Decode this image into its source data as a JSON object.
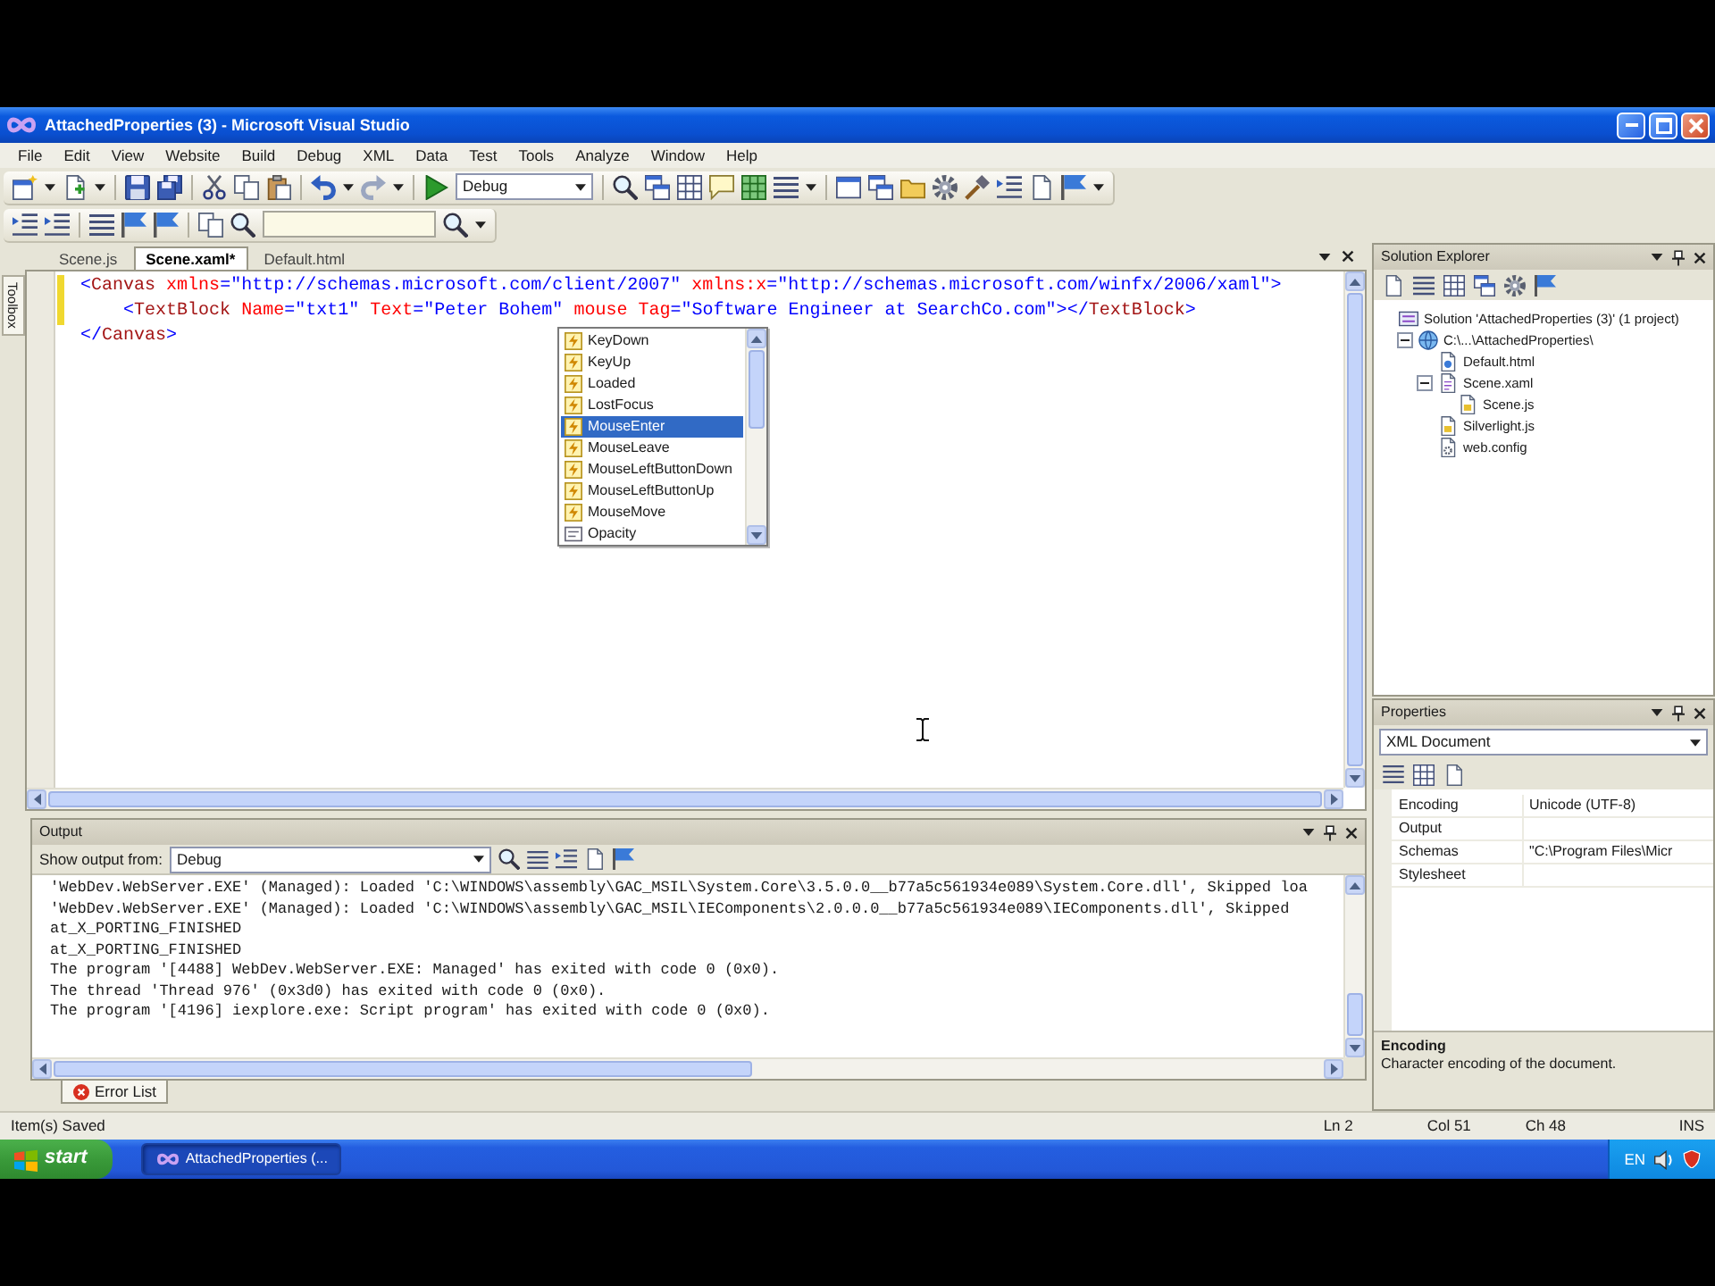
{
  "window": {
    "title": "AttachedProperties (3) - Microsoft Visual Studio"
  },
  "menu": [
    "File",
    "Edit",
    "View",
    "Website",
    "Build",
    "Debug",
    "XML",
    "Data",
    "Test",
    "Tools",
    "Analyze",
    "Window",
    "Help"
  ],
  "toolbar": {
    "configuration": "Debug"
  },
  "toolbox": {
    "label": "Toolbox"
  },
  "editor": {
    "tabs": [
      {
        "label": "Scene.js",
        "selected": false
      },
      {
        "label": "Scene.xaml*",
        "selected": true
      },
      {
        "label": "Default.html",
        "selected": false
      }
    ],
    "lines": [
      {
        "text": "<Canvas xmlns=\"http://schemas.microsoft.com/client/2007\" xmlns:x=\"http://schemas.microsoft.com/winfx/2006/xaml\">",
        "changed": true
      },
      {
        "text": "    <TextBlock Name=\"txt1\" Text=\"Peter Bohem\" mouse Tag=\"Software Engineer at SearchCo.com\"></TextBlock>",
        "changed": true
      },
      {
        "text": "</Canvas>",
        "changed": false
      }
    ],
    "completion": {
      "items": [
        {
          "label": "KeyDown",
          "kind": "event",
          "selected": false
        },
        {
          "label": "KeyUp",
          "kind": "event",
          "selected": false
        },
        {
          "label": "Loaded",
          "kind": "event",
          "selected": false
        },
        {
          "label": "LostFocus",
          "kind": "event",
          "selected": false
        },
        {
          "label": "MouseEnter",
          "kind": "event",
          "selected": true
        },
        {
          "label": "MouseLeave",
          "kind": "event",
          "selected": false
        },
        {
          "label": "MouseLeftButtonDown",
          "kind": "event",
          "selected": false
        },
        {
          "label": "MouseLeftButtonUp",
          "kind": "event",
          "selected": false
        },
        {
          "label": "MouseMove",
          "kind": "event",
          "selected": false
        },
        {
          "label": "Opacity",
          "kind": "property",
          "selected": false
        }
      ]
    }
  },
  "solution_explorer": {
    "title": "Solution Explorer",
    "tree": [
      {
        "label": "Solution 'AttachedProperties (3)' (1 project)",
        "kind": "solution",
        "children": [
          {
            "label": "C:\\...\\AttachedProperties\\",
            "kind": "website",
            "expanded": true,
            "children": [
              {
                "label": "Default.html",
                "kind": "html"
              },
              {
                "label": "Scene.xaml",
                "kind": "xaml",
                "expanded": true,
                "children": [
                  {
                    "label": "Scene.js",
                    "kind": "js"
                  }
                ]
              },
              {
                "label": "Silverlight.js",
                "kind": "js"
              },
              {
                "label": "web.config",
                "kind": "config"
              }
            ]
          }
        ]
      }
    ]
  },
  "properties": {
    "title": "Properties",
    "object": "XML Document",
    "rows": [
      {
        "name": "Encoding",
        "value": "Unicode (UTF-8)"
      },
      {
        "name": "Output"
      },
      {
        "name": "Schemas",
        "value": "\"C:\\Program Files\\Micr"
      },
      {
        "name": "Stylesheet"
      }
    ],
    "description": {
      "title": "Encoding",
      "text": "Character encoding of the document."
    }
  },
  "output": {
    "title": "Output",
    "source_label": "Show output from:",
    "source": "Debug",
    "lines": [
      "'WebDev.WebServer.EXE' (Managed): Loaded 'C:\\WINDOWS\\assembly\\GAC_MSIL\\System.Core\\3.5.0.0__b77a5c561934e089\\System.Core.dll', Skipped loa",
      "'WebDev.WebServer.EXE' (Managed): Loaded 'C:\\WINDOWS\\assembly\\GAC_MSIL\\IEComponents\\2.0.0.0__b77a5c561934e089\\IEComponents.dll', Skipped",
      "at_X_PORTING_FINISHED",
      "at_X_PORTING_FINISHED",
      "The program '[4488] WebDev.WebServer.EXE: Managed' has exited with code 0 (0x0).",
      "The thread 'Thread 976' (0x3d0) has exited with code 0 (0x0).",
      "The program '[4196] iexplore.exe: Script program' has exited with code 0 (0x0)."
    ]
  },
  "bottom_tabs": [
    {
      "label": "Error List"
    }
  ],
  "status_bar": {
    "message": "Item(s) Saved",
    "line": "Ln 2",
    "column": "Col 51",
    "char": "Ch 48",
    "mode": "INS"
  },
  "taskbar": {
    "start": "start",
    "tasks": [
      {
        "label": "AttachedProperties (...",
        "selected": true
      }
    ],
    "language": "EN"
  }
}
